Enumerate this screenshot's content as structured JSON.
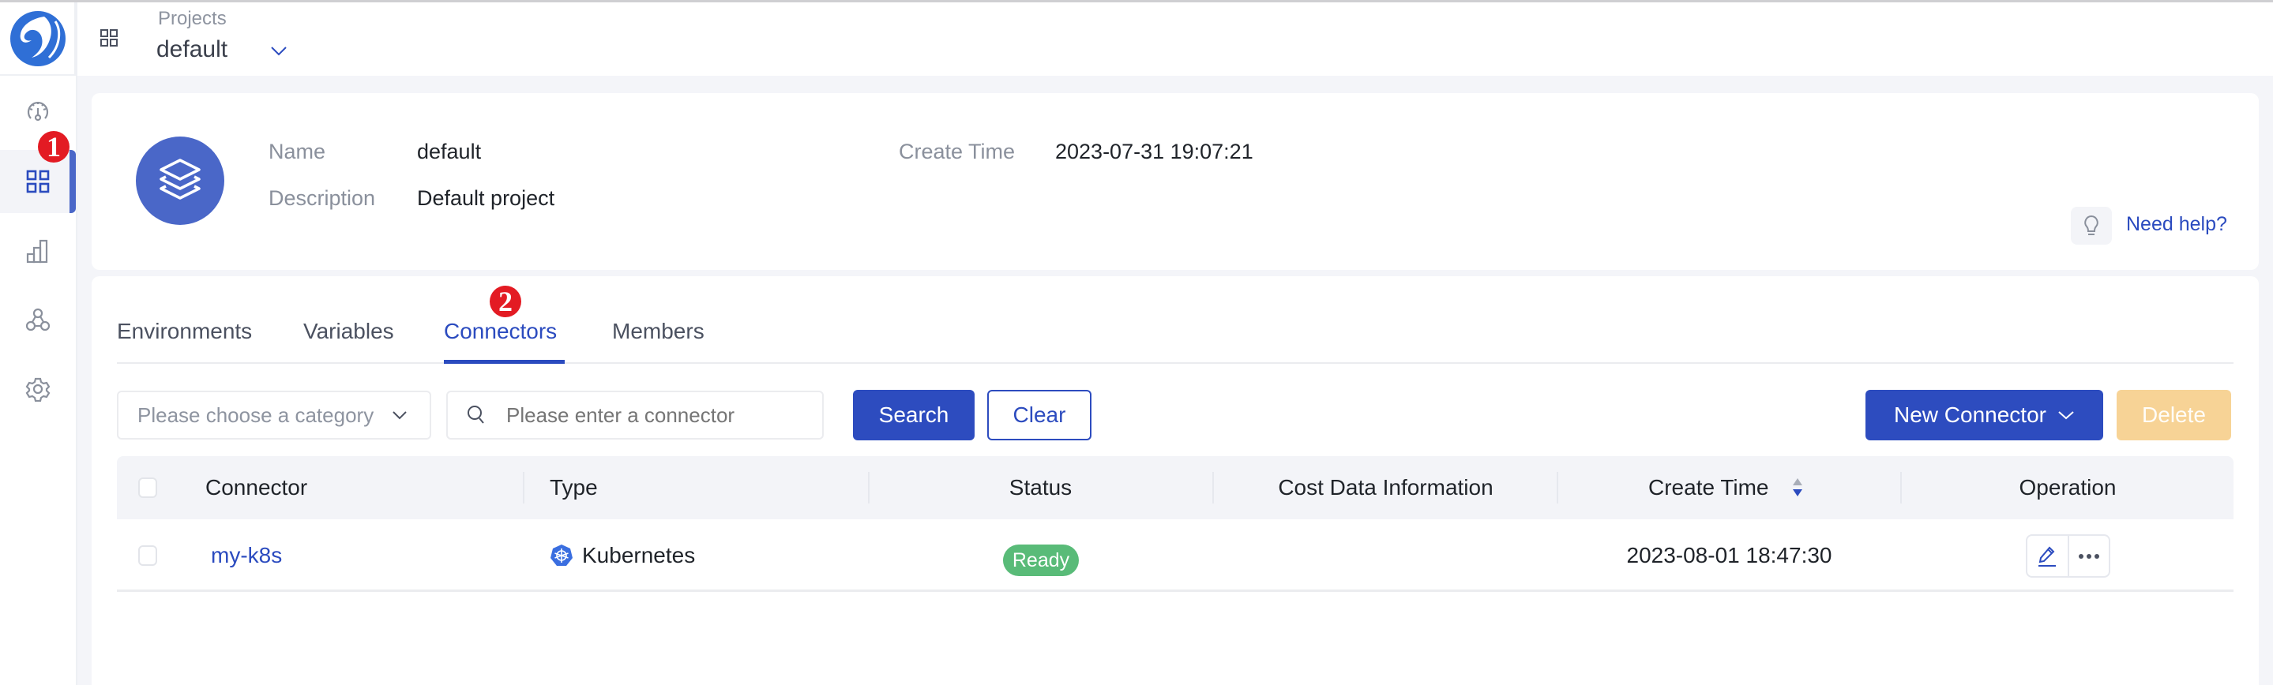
{
  "header": {
    "project_label": "Projects",
    "project_value": "default"
  },
  "sidebar": {
    "items": [
      {
        "name": "dashboard",
        "icon": "speedometer-icon",
        "active": false
      },
      {
        "name": "projects",
        "icon": "grid-icon",
        "active": true
      },
      {
        "name": "cost",
        "icon": "bar-chart-icon",
        "active": false
      },
      {
        "name": "operators",
        "icon": "network-icon",
        "active": false
      },
      {
        "name": "settings",
        "icon": "gear-icon",
        "active": false
      }
    ],
    "annotation": "1"
  },
  "project_info": {
    "name_label": "Name",
    "name_value": "default",
    "description_label": "Description",
    "description_value": "Default project",
    "create_time_label": "Create Time",
    "create_time_value": "2023-07-31 19:07:21",
    "help_link": "Need help?"
  },
  "tabs": {
    "items": [
      "Environments",
      "Variables",
      "Connectors",
      "Members"
    ],
    "active": "Connectors",
    "annotation": "2"
  },
  "filters": {
    "category_placeholder": "Please choose a category",
    "connector_placeholder": "Please enter a connector",
    "search_label": "Search",
    "clear_label": "Clear",
    "new_connector_label": "New Connector",
    "delete_label": "Delete"
  },
  "table": {
    "columns": [
      "Connector",
      "Type",
      "Status",
      "Cost Data Information",
      "Create Time",
      "Operation"
    ],
    "rows": [
      {
        "connector": "my-k8s",
        "type": "Kubernetes",
        "status": "Ready",
        "cost_data": "",
        "create_time": "2023-08-01 18:47:30"
      }
    ]
  },
  "colors": {
    "primary": "#2D4CBF",
    "avatar": "#4A67C8",
    "ready": "#59BB78",
    "delete_disabled": "#F7D396",
    "annotation_badge": "#E31B23"
  }
}
